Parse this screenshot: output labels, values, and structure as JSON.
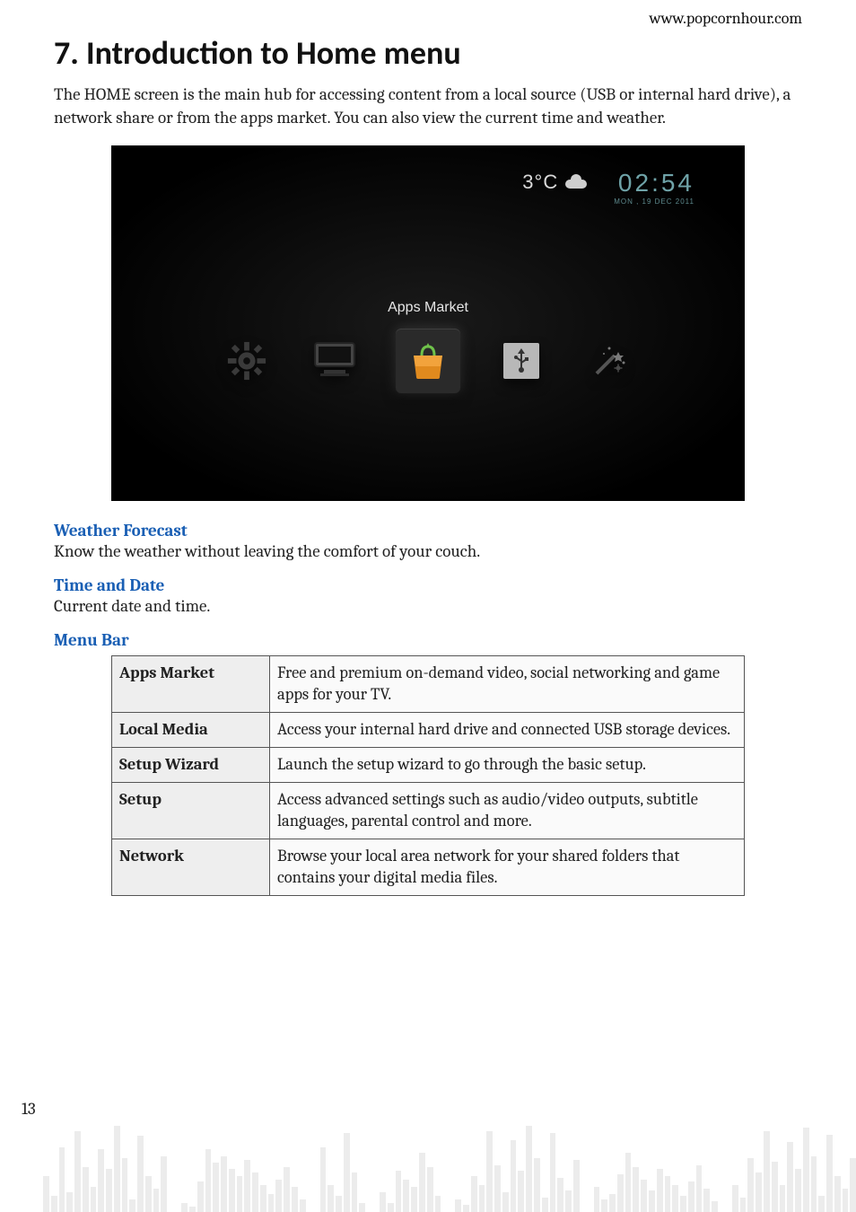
{
  "header": {
    "url": "www.popcornhour.com"
  },
  "title": "7. Introduction to Home menu",
  "intro": "The HOME screen is the main hub for accessing content from a local source (USB or internal hard drive), a network share or from the apps market. You can also view the current time and weather.",
  "screenshot": {
    "weather_temp": "3°C",
    "time": "02:54",
    "date": "MON , 19 DEC 2011",
    "selected_label": "Apps Market",
    "menu_items": [
      {
        "name": "setup-gear"
      },
      {
        "name": "local-media-monitor"
      },
      {
        "name": "apps-market",
        "selected": true
      },
      {
        "name": "usb"
      },
      {
        "name": "setup-wizard-wand"
      }
    ]
  },
  "sections": [
    {
      "label": "Weather Forecast",
      "text": "Know the weather without leaving the comfort of your couch."
    },
    {
      "label": "Time and Date",
      "text": "Current date and time."
    },
    {
      "label": "Menu Bar",
      "text": ""
    }
  ],
  "table": [
    {
      "name": "Apps Market",
      "desc": "Free and premium on-demand video, social networking and game apps for your TV."
    },
    {
      "name": "Local Media",
      "desc": "Access your internal hard drive and connected USB storage devices."
    },
    {
      "name": "Setup Wizard",
      "desc": "Launch the setup wizard to go through the basic setup."
    },
    {
      "name": "Setup",
      "desc": "Access advanced settings such as audio/video outputs, subtitle languages, parental control and more."
    },
    {
      "name": "Network",
      "desc": "Browse your local area network for your shared folders that contains your digital media files."
    }
  ],
  "page_number": "13"
}
